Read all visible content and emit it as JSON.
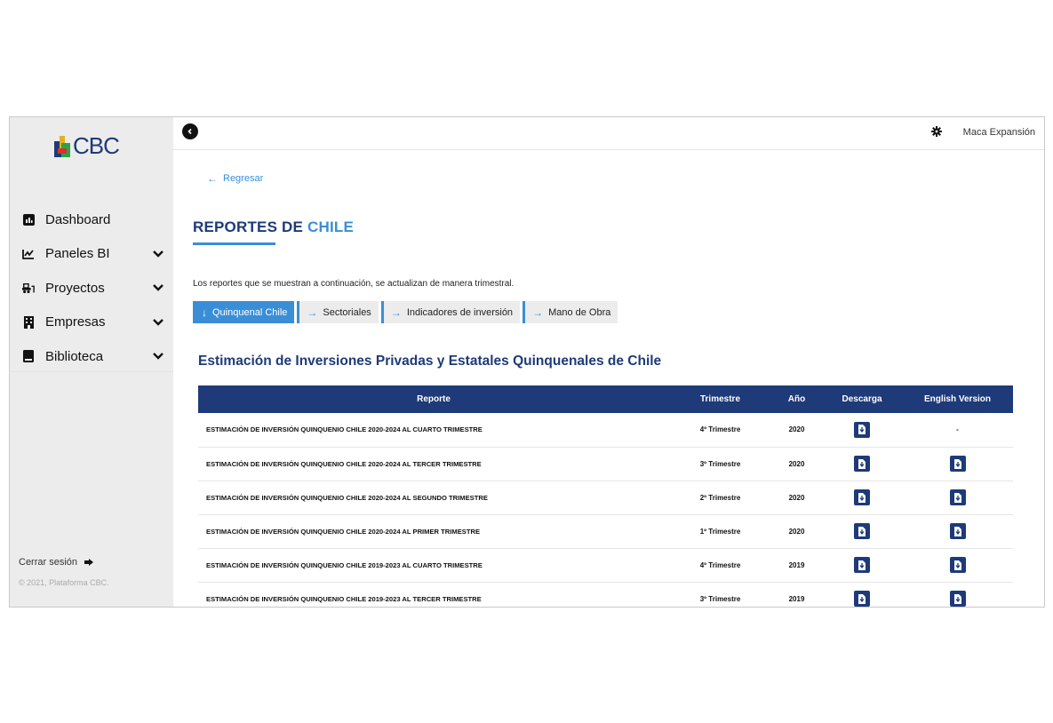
{
  "brand": {
    "logo_text": "CBC",
    "colors": {
      "navy": "#1e3a78",
      "blue": "#3a8ed6",
      "yellow": "#e2b21f",
      "green": "#2aa448",
      "red": "#d6322c"
    }
  },
  "sidebar": {
    "items": [
      {
        "label": "Dashboard",
        "icon": "chart-bar-icon",
        "expandable": false
      },
      {
        "label": "Paneles BI",
        "icon": "line-chart-icon",
        "expandable": true
      },
      {
        "label": "Proyectos",
        "icon": "bulldozer-icon",
        "expandable": true
      },
      {
        "label": "Empresas",
        "icon": "building-icon",
        "expandable": true
      },
      {
        "label": "Biblioteca",
        "icon": "book-icon",
        "expandable": true
      }
    ],
    "logout_label": "Cerrar sesión",
    "copyright": "© 2021, Plataforma CBC."
  },
  "topbar": {
    "user": "Maca Expansión"
  },
  "page": {
    "back_label": "Regresar",
    "title_part1": "REPORTES DE ",
    "title_part2": "CHILE",
    "intro": "Los reportes que se muestran a continuación, se actualizan de manera trimestral.",
    "tabs": [
      {
        "label": "Quinquenal Chile",
        "active": true
      },
      {
        "label": "Sectoriales",
        "active": false
      },
      {
        "label": "Indicadores de inversión",
        "active": false
      },
      {
        "label": "Mano de Obra",
        "active": false
      }
    ],
    "section_title": "Estimación de Inversiones Privadas y Estatales Quinquenales de Chile"
  },
  "table": {
    "headers": [
      "Reporte",
      "Trimestre",
      "Año",
      "Descarga",
      "English Version"
    ],
    "rows": [
      {
        "reporte": "ESTIMACIÓN DE INVERSIÓN QUINQUENIO CHILE 2020-2024 AL CUARTO TRIMESTRE",
        "trimestre": "4º Trimestre",
        "anio": "2020",
        "english": "-"
      },
      {
        "reporte": "ESTIMACIÓN DE INVERSIÓN QUINQUENIO CHILE 2020-2024 AL TERCER TRIMESTRE",
        "trimestre": "3º Trimestre",
        "anio": "2020",
        "english": "download"
      },
      {
        "reporte": "ESTIMACIÓN DE INVERSIÓN QUINQUENIO CHILE 2020-2024 AL SEGUNDO TRIMESTRE",
        "trimestre": "2º Trimestre",
        "anio": "2020",
        "english": "download"
      },
      {
        "reporte": "ESTIMACIÓN DE INVERSIÓN QUINQUENIO CHILE 2020-2024 AL PRIMER TRIMESTRE",
        "trimestre": "1º Trimestre",
        "anio": "2020",
        "english": "download"
      },
      {
        "reporte": "ESTIMACIÓN DE INVERSIÓN QUINQUENIO CHILE 2019-2023 AL CUARTO TRIMESTRE",
        "trimestre": "4º Trimestre",
        "anio": "2019",
        "english": "download"
      },
      {
        "reporte": "ESTIMACIÓN DE INVERSIÓN QUINQUENIO CHILE 2019-2023 AL TERCER TRIMESTRE",
        "trimestre": "3º Trimestre",
        "anio": "2019",
        "english": "download"
      }
    ]
  }
}
